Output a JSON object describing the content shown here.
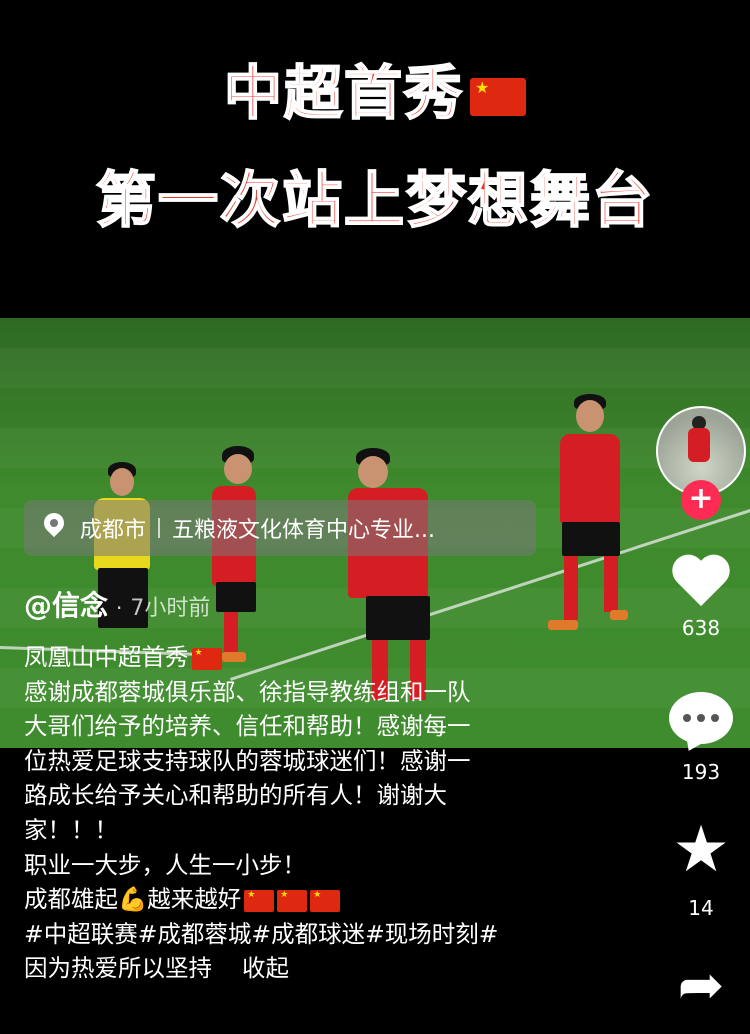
{
  "title": {
    "line1": "中超首秀",
    "line2": "第一次站上梦想舞台"
  },
  "location": {
    "city": "成都市",
    "place": "五粮液文化体育中心专业..."
  },
  "post": {
    "author": "@信念",
    "dot": "·",
    "time": "7小时前",
    "caption_lines": [
      "凤凰山中超首秀",
      "感谢成都蓉城俱乐部、徐指导教练组和一队",
      "大哥们给予的培养、信任和帮助！感谢每一",
      "位热爱足球支持球队的蓉城球迷们！感谢一",
      "路成长给予关心和帮助的所有人！谢谢大",
      "家！！！",
      "职业一大步，人生一小步！",
      "成都雄起",
      "越来越好",
      "#中超联赛#成都蓉城#成都球迷#现场时刻#",
      "因为热爱所以坚持"
    ],
    "muscle_emoji": "💪",
    "expand_label": "收起"
  },
  "actions": {
    "follow_symbol": "+",
    "likes": "638",
    "comments": "193",
    "favorites": "14"
  },
  "icons": {
    "flag": "china-flag-icon",
    "like": "heart-icon",
    "comment": "comment-bubble-icon",
    "favorite": "star-icon",
    "share": "share-arrow-icon",
    "location": "location-pin-icon"
  },
  "colors": {
    "title_red": "#e8352a",
    "follow_pink": "#fe2c55",
    "jersey_red": "#d41e23"
  }
}
